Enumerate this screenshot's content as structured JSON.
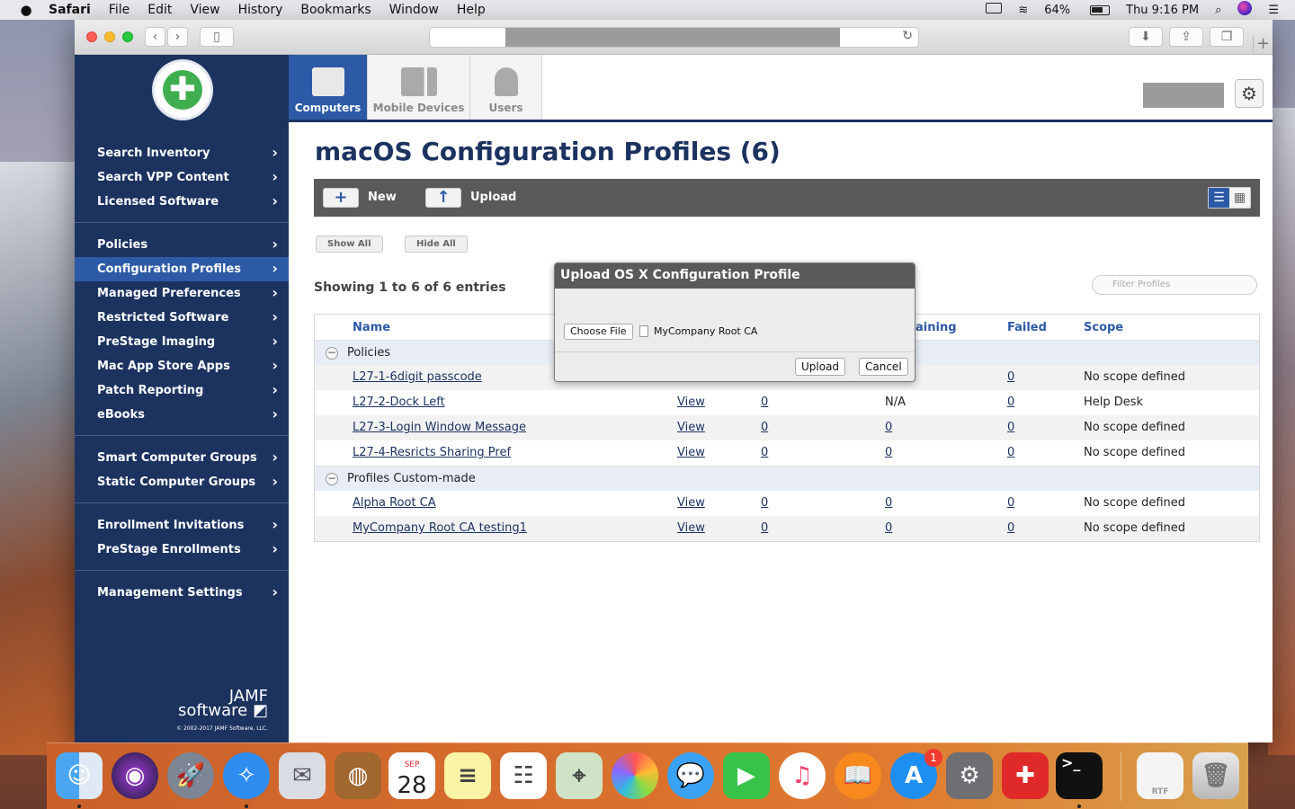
{
  "menubar": {
    "app": "Safari",
    "items": [
      "File",
      "Edit",
      "View",
      "History",
      "Bookmarks",
      "Window",
      "Help"
    ],
    "battery": "64%",
    "clock": "Thu 9:16 PM"
  },
  "sidebar": {
    "groups": [
      [
        "Search Inventory",
        "Search VPP Content",
        "Licensed Software"
      ],
      [
        "Policies",
        "Configuration Profiles",
        "Managed Preferences",
        "Restricted Software",
        "PreStage Imaging",
        "Mac App Store Apps",
        "Patch Reporting",
        "eBooks"
      ],
      [
        "Smart Computer Groups",
        "Static Computer Groups"
      ],
      [
        "Enrollment Invitations",
        "PreStage Enrollments"
      ],
      [
        "Management Settings"
      ]
    ],
    "active": "Configuration Profiles",
    "footer_brand_top": "JAMF",
    "footer_brand": "software",
    "footer_copyright": "© 2002-2017 JAMF Software, LLC."
  },
  "tabs": {
    "computers": "Computers",
    "mobile": "Mobile Devices",
    "users": "Users"
  },
  "page": {
    "title": "macOS Configuration Profiles (6)",
    "new_label": "New",
    "upload_label": "Upload",
    "show_all": "Show All",
    "hide_all": "Hide All",
    "showing": "Showing 1 to 6 of 6 entries",
    "filter_placeholder": "Filter Profiles"
  },
  "table": {
    "headers": {
      "name": "Name",
      "remaining": "aining",
      "failed": "Failed",
      "scope": "Scope"
    },
    "groups": [
      {
        "label": "Policies",
        "rows": [
          {
            "name": "L27-1-6digit passcode",
            "view": "",
            "completed": "",
            "remaining": "",
            "failed": "0",
            "scope": "No scope defined"
          },
          {
            "name": "L27-2-Dock Left",
            "view": "View",
            "completed": "0",
            "remaining": "N/A",
            "failed": "0",
            "scope": "Help Desk"
          },
          {
            "name": "L27-3-Login Window Message",
            "view": "View",
            "completed": "0",
            "remaining": "0",
            "failed": "0",
            "scope": "No scope defined"
          },
          {
            "name": "L27-4-Resricts Sharing Pref",
            "view": "View",
            "completed": "0",
            "remaining": "0",
            "failed": "0",
            "scope": "No scope defined"
          }
        ]
      },
      {
        "label": "Profiles Custom-made",
        "rows": [
          {
            "name": "Alpha Root CA",
            "view": "View",
            "completed": "0",
            "remaining": "0",
            "failed": "0",
            "scope": "No scope defined"
          },
          {
            "name": "MyCompany Root CA testing1",
            "view": "View",
            "completed": "0",
            "remaining": "0",
            "failed": "0",
            "scope": "No scope defined"
          }
        ]
      }
    ]
  },
  "modal": {
    "title": "Upload OS X Configuration Profile",
    "choose_file": "Choose File",
    "file_name": "MyCompany Root CA",
    "upload": "Upload",
    "cancel": "Cancel"
  },
  "dock": {
    "calendar_month": "SEP",
    "calendar_day": "28",
    "appstore_badge": "1"
  }
}
